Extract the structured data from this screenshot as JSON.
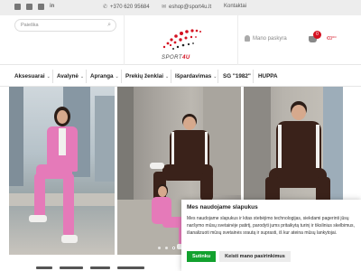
{
  "topbar": {
    "social_icons": [
      "facebook-icon",
      "instagram-icon",
      "youtube-icon",
      "linkedin-icon"
    ],
    "linkedin_text": "in",
    "phone": "+370 620 95684",
    "email": "eshop@sport4u.lt",
    "contacts": "Kontaktai"
  },
  "header": {
    "search_placeholder": "Paieška",
    "logo_prefix": "SPORT",
    "logo_suffix": "4U",
    "account_label": "Mano paskyra",
    "cart_count": "0",
    "cart_total": "€0⁰⁰"
  },
  "nav": {
    "items": [
      {
        "label": "Aksesuarai",
        "chevron": "⌄"
      },
      {
        "label": "Avalynė",
        "chevron": "⌄"
      },
      {
        "label": "Apranga",
        "chevron": "⌄"
      },
      {
        "label": "Prekių ženklai",
        "chevron": "⌄"
      },
      {
        "label": "Išpardavimas",
        "chevron": "⌄"
      },
      {
        "label": "SG \"1982\"",
        "chevron": ""
      },
      {
        "label": "HUPPA",
        "chevron": ""
      }
    ]
  },
  "slider": {
    "dots": 4,
    "active_dot": 2
  },
  "cookie": {
    "title": "Mes naudojame slapukus",
    "text": "Mes naudojame slapukus ir kitas stebėjimo technologijas, siekdami pagerinti jūsų naršymo mūsų svetainėje patirtį, parodyti jums pritaikytą turinį ir tikslinius skelbimus, išanalizuoti mūsų svetainės srautą ir suprasti, iš kur ateina mūsų lankytojai.",
    "accept_label": "Sutinku",
    "settings_label": "Keisti mano pasirinkimus"
  },
  "colors": {
    "brand_red": "#d41020",
    "accept_green": "#12a12e"
  }
}
